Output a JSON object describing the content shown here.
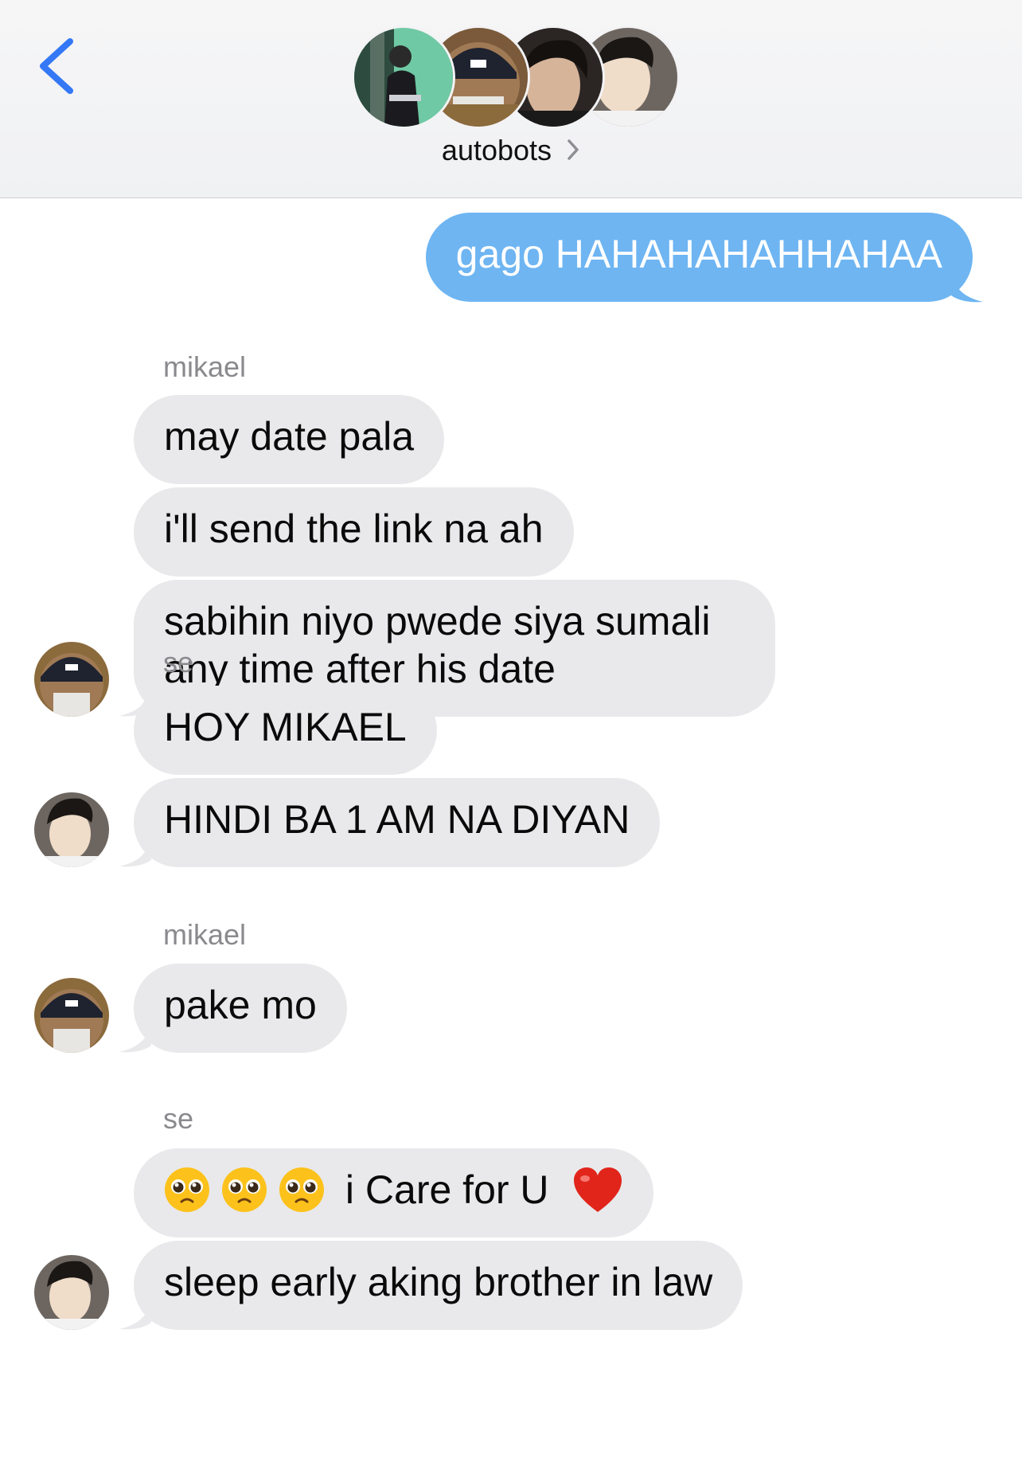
{
  "header": {
    "group_name": "autobots"
  },
  "messages": {
    "m1": "gago HAHAHAHAHHAHAA",
    "sender1": "mikael",
    "m2": "may date pala",
    "m3": "i'll send the link na ah",
    "m4_line1": "sabihin niyo pwede siya sumali",
    "m4_line2": "any time after his date",
    "sender2": "se",
    "m5": "HOY MIKAEL",
    "m6": "HINDI BA 1 AM NA DIYAN",
    "sender3": "mikael",
    "m7": "pake mo",
    "sender4": "se",
    "m8_text": "i Care for U",
    "m9": "sleep early aking brother in law"
  },
  "icons": {
    "back": "chevron-left-icon",
    "header_chevron": "chevron-right-icon",
    "emoji": "pleading-face-emoji",
    "heart": "red-heart-emoji"
  },
  "colors": {
    "outgoing_bubble": "#6eb5f2",
    "incoming_bubble": "#e9e9eb",
    "back_chevron": "#3478f6",
    "sender_label": "#8a8a8e"
  }
}
